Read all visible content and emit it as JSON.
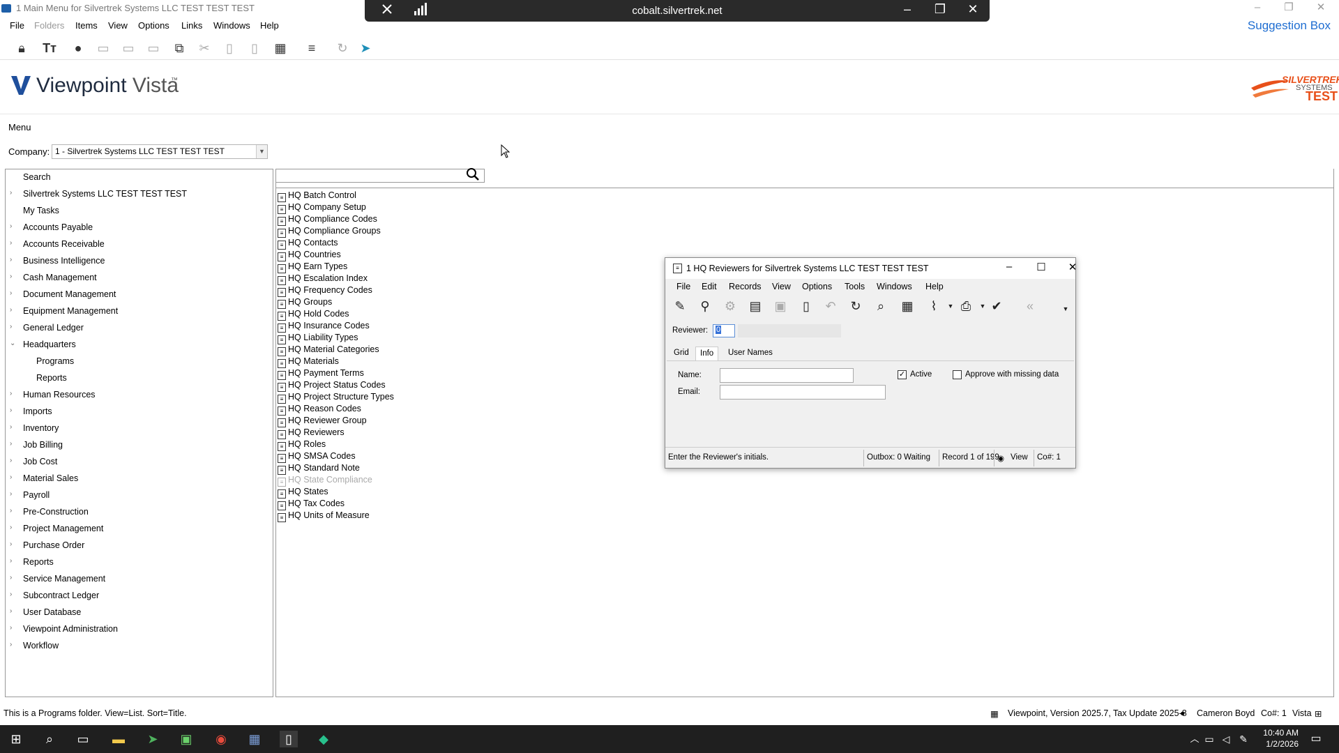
{
  "window": {
    "title": "1 Main Menu for Silvertrek Systems LLC TEST TEST TEST",
    "minimize": "–",
    "restore": "❐",
    "close": "✕"
  },
  "remote": {
    "host": "cobalt.silvertrek.net",
    "pin_icon": "✕",
    "signal_icon": "▮",
    "minimize": "–",
    "restore": "❐",
    "close": "✕"
  },
  "menubar": {
    "items": [
      "File",
      "Folders",
      "Items",
      "View",
      "Options",
      "Links",
      "Windows",
      "Help"
    ],
    "suggestion": "Suggestion Box"
  },
  "toolbar": {
    "icons": [
      "lock-icon",
      "font-icon",
      "palette-icon",
      "new-folder-icon",
      "edit-folder-icon",
      "folder-icon",
      "copy-icon",
      "cut-icon",
      "paste-icon",
      "delete-icon",
      "grid-icon",
      "sort-icon",
      "refresh-icon",
      "run-icon"
    ]
  },
  "header": {
    "brand": "Viewpoint",
    "brand2": "Vista",
    "tm": "™",
    "company_logo": [
      "SILVERTREK",
      "SYSTEMS",
      "TEST"
    ]
  },
  "menu_label": "Menu",
  "company": {
    "label": "Company:",
    "value": "1 - Silvertrek Systems LLC TEST TEST TEST"
  },
  "tree": [
    {
      "label": "Search",
      "expander": "",
      "indent": 0
    },
    {
      "label": "Silvertrek Systems LLC TEST TEST TEST",
      "expander": "›",
      "indent": 0
    },
    {
      "label": "My Tasks",
      "expander": "",
      "indent": 0
    },
    {
      "label": "Accounts Payable",
      "expander": "›",
      "indent": 0
    },
    {
      "label": "Accounts Receivable",
      "expander": "›",
      "indent": 0
    },
    {
      "label": "Business Intelligence",
      "expander": "›",
      "indent": 0
    },
    {
      "label": "Cash Management",
      "expander": "›",
      "indent": 0
    },
    {
      "label": "Document Management",
      "expander": "›",
      "indent": 0
    },
    {
      "label": "Equipment Management",
      "expander": "›",
      "indent": 0
    },
    {
      "label": "General Ledger",
      "expander": "›",
      "indent": 0
    },
    {
      "label": "Headquarters",
      "expander": "⌄",
      "indent": 0
    },
    {
      "label": "Programs",
      "expander": "",
      "indent": 1
    },
    {
      "label": "Reports",
      "expander": "",
      "indent": 1
    },
    {
      "label": "Human Resources",
      "expander": "›",
      "indent": 0
    },
    {
      "label": "Imports",
      "expander": "›",
      "indent": 0
    },
    {
      "label": "Inventory",
      "expander": "›",
      "indent": 0
    },
    {
      "label": "Job Billing",
      "expander": "›",
      "indent": 0
    },
    {
      "label": "Job Cost",
      "expander": "›",
      "indent": 0
    },
    {
      "label": "Material Sales",
      "expander": "›",
      "indent": 0
    },
    {
      "label": "Payroll",
      "expander": "›",
      "indent": 0
    },
    {
      "label": "Pre-Construction",
      "expander": "›",
      "indent": 0
    },
    {
      "label": "Project Management",
      "expander": "›",
      "indent": 0
    },
    {
      "label": "Purchase Order",
      "expander": "›",
      "indent": 0
    },
    {
      "label": "Reports",
      "expander": "›",
      "indent": 0
    },
    {
      "label": "Service Management",
      "expander": "›",
      "indent": 0
    },
    {
      "label": "Subcontract Ledger",
      "expander": "›",
      "indent": 0
    },
    {
      "label": "User Database",
      "expander": "›",
      "indent": 0
    },
    {
      "label": "Viewpoint Administration",
      "expander": "›",
      "indent": 0
    },
    {
      "label": "Workflow",
      "expander": "›",
      "indent": 0
    }
  ],
  "programs": [
    {
      "label": "HQ Batch Control",
      "disabled": false
    },
    {
      "label": "HQ Company Setup",
      "disabled": false
    },
    {
      "label": "HQ Compliance Codes",
      "disabled": false
    },
    {
      "label": "HQ Compliance Groups",
      "disabled": false
    },
    {
      "label": "HQ Contacts",
      "disabled": false
    },
    {
      "label": "HQ Countries",
      "disabled": false
    },
    {
      "label": "HQ Earn Types",
      "disabled": false
    },
    {
      "label": "HQ Escalation Index",
      "disabled": false
    },
    {
      "label": "HQ Frequency Codes",
      "disabled": false
    },
    {
      "label": "HQ Groups",
      "disabled": false
    },
    {
      "label": "HQ Hold Codes",
      "disabled": false
    },
    {
      "label": "HQ Insurance Codes",
      "disabled": false
    },
    {
      "label": "HQ Liability Types",
      "disabled": false
    },
    {
      "label": "HQ Material Categories",
      "disabled": false
    },
    {
      "label": "HQ Materials",
      "disabled": false
    },
    {
      "label": "HQ Payment Terms",
      "disabled": false
    },
    {
      "label": "HQ Project Status Codes",
      "disabled": false
    },
    {
      "label": "HQ Project Structure Types",
      "disabled": false
    },
    {
      "label": "HQ Reason Codes",
      "disabled": false
    },
    {
      "label": "HQ Reviewer Group",
      "disabled": false
    },
    {
      "label": "HQ Reviewers",
      "disabled": false
    },
    {
      "label": "HQ Roles",
      "disabled": false
    },
    {
      "label": "HQ SMSA Codes",
      "disabled": false
    },
    {
      "label": "HQ Standard Note",
      "disabled": false
    },
    {
      "label": "HQ State Compliance",
      "disabled": true
    },
    {
      "label": "HQ States",
      "disabled": false
    },
    {
      "label": "HQ Tax Codes",
      "disabled": false
    },
    {
      "label": "HQ Units of Measure",
      "disabled": false
    }
  ],
  "dialog": {
    "title": "1 HQ Reviewers for Silvertrek Systems LLC TEST TEST TEST",
    "menu": [
      "File",
      "Edit",
      "Records",
      "View",
      "Options",
      "Tools",
      "Windows",
      "Help"
    ],
    "reviewer_label": "Reviewer:",
    "reviewer_value": "0",
    "tabs": [
      "Grid",
      "Info",
      "User Names"
    ],
    "active_tab": "Info",
    "name_label": "Name:",
    "email_label": "Email:",
    "name_value": "",
    "email_value": "",
    "active_label": "Active",
    "active_checked": true,
    "approve_label": "Approve with missing data",
    "approve_checked": false,
    "status": {
      "hint": "Enter the Reviewer's initials.",
      "outbox": "Outbox: 0 Waiting",
      "record": "Record 1 of 199",
      "view": "View",
      "co": "Co#: 1"
    }
  },
  "status_bar": {
    "left": "This is a Programs folder. View=List. Sort=Title.",
    "version": "Viewpoint, Version 2025.7, Tax Update 2025-8",
    "user": "Cameron Boyd",
    "co": "Co#: 1",
    "mode": "Vista"
  },
  "taskbar": {
    "time": "10:40 AM",
    "date": "1/2/2026"
  }
}
